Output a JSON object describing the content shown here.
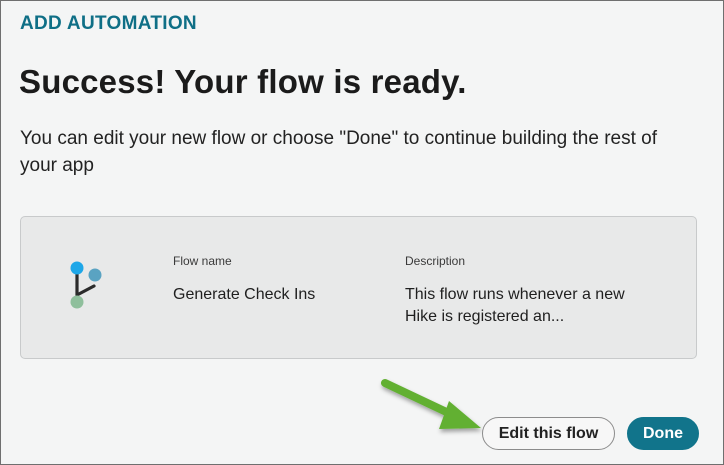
{
  "dialog": {
    "eyebrow": "ADD AUTOMATION",
    "title": "Success! Your flow is ready.",
    "subtitle": "You can edit your new flow or choose \"Done\" to continue building the rest of your app"
  },
  "flow_card": {
    "icon": "flow-branch-icon",
    "name_label": "Flow name",
    "name_value": "Generate Check Ins",
    "description_label": "Description",
    "description_value": "This flow runs whenever a new Hike is registered an..."
  },
  "actions": {
    "edit_label": "Edit this flow",
    "done_label": "Done"
  },
  "colors": {
    "accent": "#11748b",
    "eyebrow": "#0f6f86",
    "annotation_arrow": "#62b033",
    "icon_top": "#1ea7e8",
    "icon_right": "#5aa3c2",
    "icon_bottom": "#8fbf9c"
  }
}
